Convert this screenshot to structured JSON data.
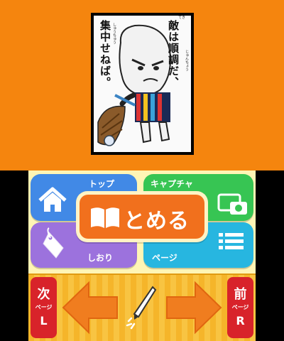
{
  "top_screen": {
    "panel": {
      "speech_right": "敵は順調だ、",
      "speech_left": "集中せねば。",
      "furigana_right": [
        "てき",
        "じゅんちょう"
      ],
      "furigana_left": "しゅうちゅう"
    }
  },
  "menu": {
    "top_label": "トップ",
    "capture_label": "キャプチャ",
    "bookmark_label": "しおり",
    "page_label": "ページ",
    "close_label": "とめる"
  },
  "nav": {
    "next_big": "次",
    "next_small": "ページ",
    "next_key": "L",
    "prev_big": "前",
    "prev_small": "ページ",
    "prev_key": "R"
  },
  "colors": {
    "top_background": "#f5850e",
    "home_blue": "#4189e6",
    "capture_green": "#37c553",
    "bookmark_purple": "#9c72dd",
    "page_cyan": "#27b6e0",
    "close_orange": "#f1701d",
    "page_turn_red": "#d8232a",
    "dock_yellow": "#f5b52a"
  },
  "icons": [
    "home-icon",
    "camera-capture-icon",
    "bookmark-tag-icon",
    "list-icon",
    "book-icon",
    "left-arrow-icon",
    "right-arrow-icon",
    "pen-icon"
  ]
}
